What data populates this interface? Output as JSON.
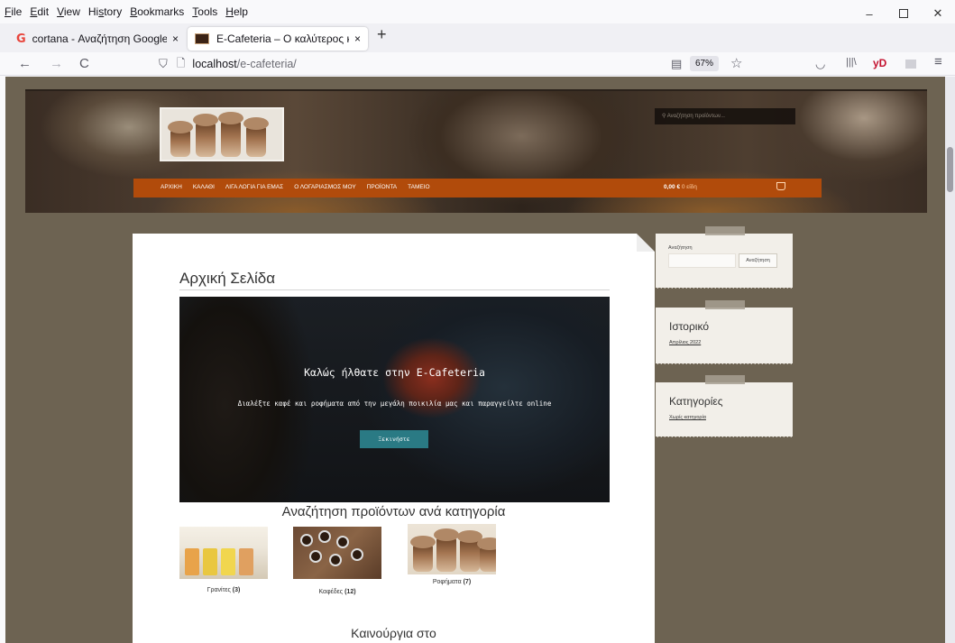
{
  "menubar": {
    "items": [
      {
        "pre": "",
        "u": "F",
        "post": "ile"
      },
      {
        "pre": "",
        "u": "E",
        "post": "dit"
      },
      {
        "pre": "",
        "u": "V",
        "post": "iew"
      },
      {
        "pre": "Hi",
        "u": "s",
        "post": "tory"
      },
      {
        "pre": "",
        "u": "B",
        "post": "ookmarks"
      },
      {
        "pre": "",
        "u": "T",
        "post": "ools"
      },
      {
        "pre": "",
        "u": "H",
        "post": "elp"
      }
    ]
  },
  "window_controls": {
    "minimize": "–",
    "close": "✕"
  },
  "tabs": [
    {
      "title": "cortana - Αναζήτηση Google",
      "close": "×",
      "icon": "google-icon"
    },
    {
      "title": "E-Cafeteria – Ο καλύτερος καφέ",
      "close": "×",
      "icon": "site-favicon"
    }
  ],
  "new_tab": "+",
  "nav": {
    "back": "←",
    "forward": "→",
    "reload": "C",
    "shield": "⛉",
    "page": "🗋",
    "url_host": "localhost",
    "url_path": "/e-cafeteria/",
    "zoom": "67%",
    "star": "☆",
    "reader": "▤",
    "pocket": "◡",
    "library": "|||\\",
    "yd": "yD",
    "menu": "≡"
  },
  "site": {
    "header_search_placeholder": "Αναζήτηση προϊόντων...",
    "menu": [
      "ΑΡΧΙΚΗ",
      "ΚΑΛΑΘΙ",
      "ΛΙΓΑ ΛΟΓΙΑ ΓΙΑ ΕΜΑΣ",
      "Ο ΛΟΓΑΡΙΑΣΜΟΣ ΜΟΥ",
      "ΠΡΟΪΟΝΤΑ",
      "ΤΑΜΕΙΟ"
    ],
    "cart_total": "0,00 €",
    "cart_items": "0 είδη"
  },
  "content": {
    "page_title": "Αρχική Σελίδα",
    "banner_heading": "Καλώς ήλθατε στην E-Cafeteria",
    "banner_text": "Διαλέξτε καφέ και ροφήματα από την μεγάλη ποικιλία μας και παραγγείλτε online",
    "banner_button": "Ξεκινήστε",
    "categories_title": "Αναζήτηση προϊόντων ανά κατηγορία",
    "categories": [
      {
        "name": "Γρανίτες",
        "count": "(3)"
      },
      {
        "name": "Καφέδες",
        "count": "(12)"
      },
      {
        "name": "Ροφήματα",
        "count": "(7)"
      }
    ],
    "new_title": "Καινούργια στο"
  },
  "sidebar": {
    "search_label": "Αναζήτηση",
    "search_button": "Αναζήτηση",
    "history_title": "Ιστορικό",
    "history_link": "Απρίλιος 2022",
    "categories_title": "Κατηγορίες",
    "categories_link": "Χωρίς κατηγορία"
  },
  "colors": {
    "nav_orange": "#b14b0b",
    "banner_button": "#2a7a84",
    "page_bg": "#6d6352"
  }
}
